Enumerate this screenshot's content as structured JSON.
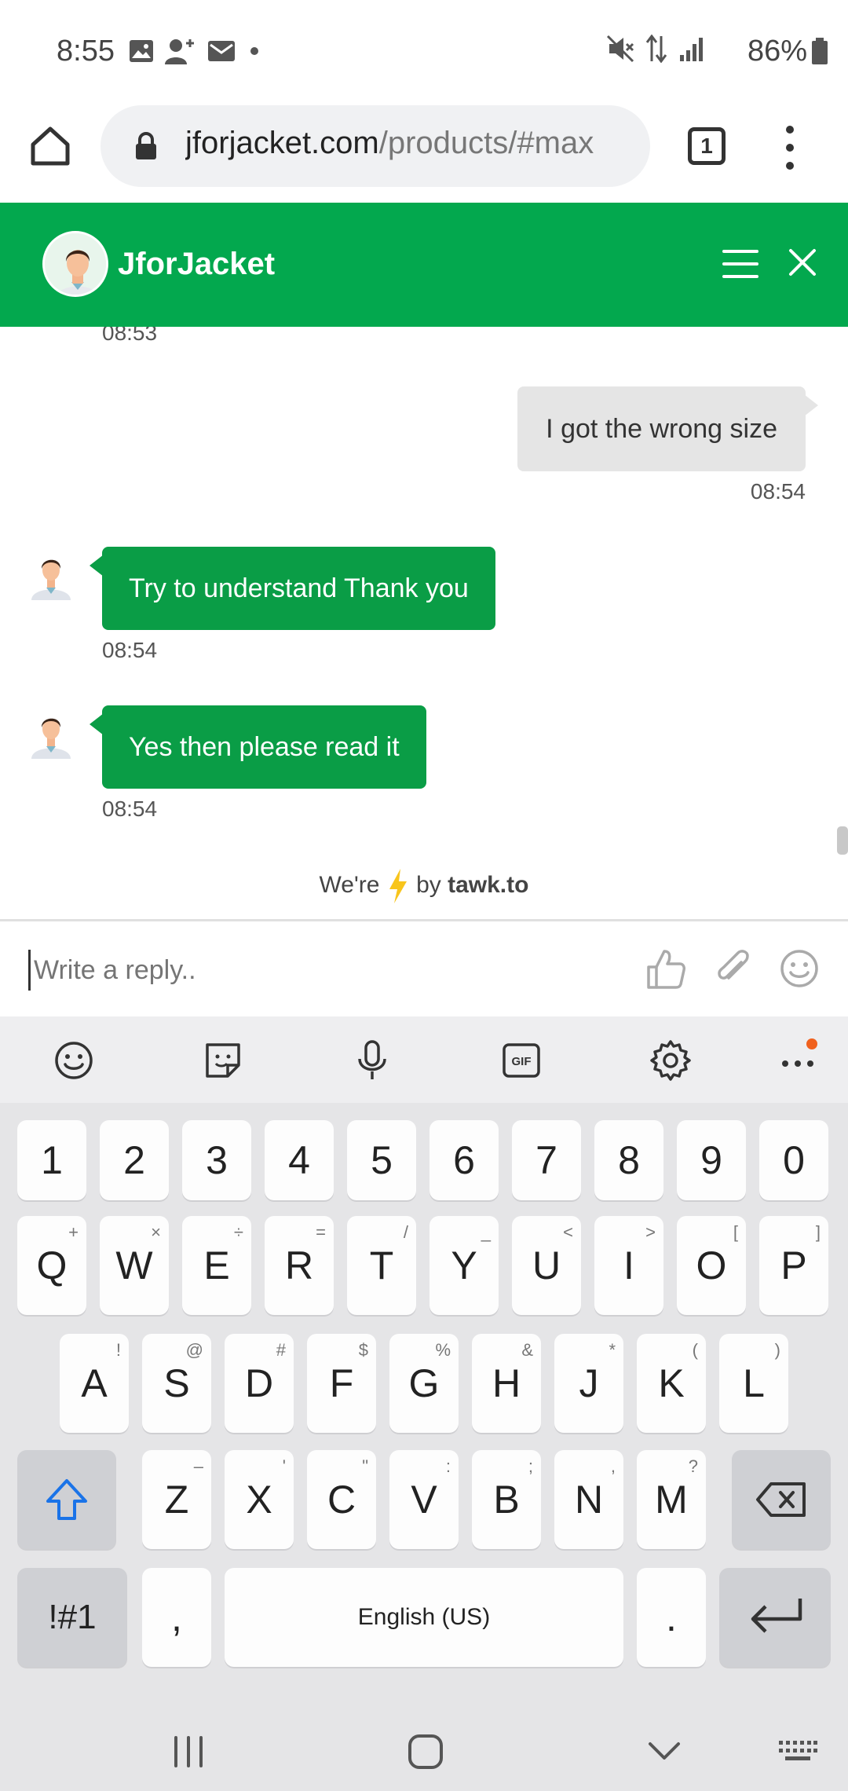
{
  "status_bar": {
    "time": "8:55",
    "battery": "86%"
  },
  "browser": {
    "url_domain": "jforjacket.com",
    "url_path": "/products/#max",
    "tab_count": "1"
  },
  "chat_header": {
    "agent_name": "JforJacket"
  },
  "messages": [
    {
      "type": "timestamp_in",
      "time": "08:53"
    },
    {
      "type": "outgoing",
      "text": "I got the wrong size",
      "time": "08:54"
    },
    {
      "type": "incoming",
      "text": "Try to understand Thank you",
      "time": "08:54"
    },
    {
      "type": "incoming",
      "text": "Yes then please read it",
      "time": "08:54"
    }
  ],
  "powered": {
    "prefix": "We're",
    "middle": "by",
    "brand": "tawk.to"
  },
  "reply": {
    "placeholder": "Write a reply.."
  },
  "keyboard": {
    "number_row": [
      "1",
      "2",
      "3",
      "4",
      "5",
      "6",
      "7",
      "8",
      "9",
      "0"
    ],
    "row1": [
      {
        "k": "Q",
        "s": "+"
      },
      {
        "k": "W",
        "s": "×"
      },
      {
        "k": "E",
        "s": "÷"
      },
      {
        "k": "R",
        "s": "="
      },
      {
        "k": "T",
        "s": "/"
      },
      {
        "k": "Y",
        "s": "_"
      },
      {
        "k": "U",
        "s": "<"
      },
      {
        "k": "I",
        "s": ">"
      },
      {
        "k": "O",
        "s": "["
      },
      {
        "k": "P",
        "s": "]"
      }
    ],
    "row2": [
      {
        "k": "A",
        "s": "!"
      },
      {
        "k": "S",
        "s": "@"
      },
      {
        "k": "D",
        "s": "#"
      },
      {
        "k": "F",
        "s": "$"
      },
      {
        "k": "G",
        "s": "%"
      },
      {
        "k": "H",
        "s": "&"
      },
      {
        "k": "J",
        "s": "*"
      },
      {
        "k": "K",
        "s": "("
      },
      {
        "k": "L",
        "s": ")"
      }
    ],
    "row3": [
      {
        "k": "Z",
        "s": "–"
      },
      {
        "k": "X",
        "s": "'"
      },
      {
        "k": "C",
        "s": "\""
      },
      {
        "k": "V",
        "s": ":"
      },
      {
        "k": "B",
        "s": ";"
      },
      {
        "k": "N",
        "s": ","
      },
      {
        "k": "M",
        "s": "?"
      }
    ],
    "symbols_key": "!#1",
    "comma_key": ",",
    "space_label": "English (US)",
    "period_key": "."
  },
  "colors": {
    "brand_green": "#03a84e",
    "bubble_green": "#0a9d46",
    "bubble_grey": "#e5e5e5",
    "notification_dot": "#f0611e",
    "shift_blue": "#1a73e8"
  }
}
